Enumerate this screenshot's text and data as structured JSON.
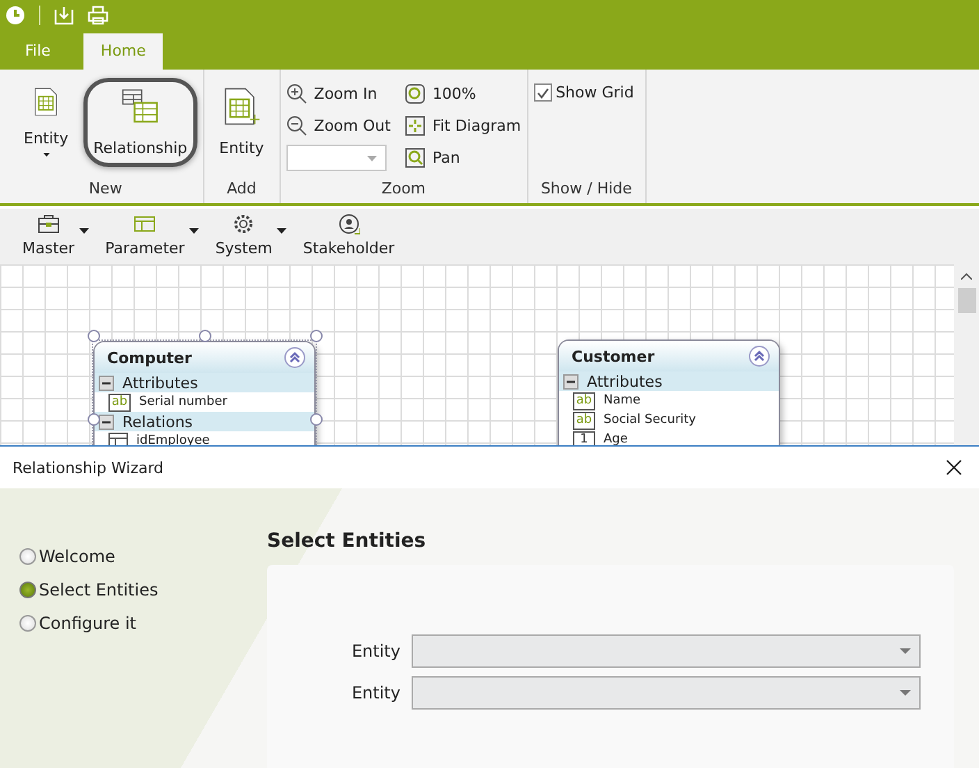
{
  "ribbon": {
    "tabs": [
      {
        "label": "File",
        "selected": false
      },
      {
        "label": "Home",
        "selected": true
      }
    ],
    "groups": [
      {
        "label": "New",
        "kind": "large",
        "buttons": [
          {
            "label": "Entity",
            "dropdown": true,
            "highlighted": false
          },
          {
            "label": "Relationship",
            "dropdown": false,
            "highlighted": true
          }
        ]
      },
      {
        "label": "Add",
        "kind": "large",
        "buttons": [
          {
            "label": "Entity",
            "dropdown": false,
            "highlighted": false
          }
        ]
      },
      {
        "label": "Zoom",
        "kind": "zoom",
        "buttons": [
          {
            "label": "Zoom In"
          },
          {
            "label": "Zoom Out"
          },
          {
            "label": "100%"
          },
          {
            "label": "Fit Diagram"
          },
          {
            "label": "Pan"
          }
        ]
      },
      {
        "label": "Show / Hide",
        "kind": "checks",
        "items": [
          {
            "label": "Show Grid",
            "checked": true
          }
        ]
      }
    ]
  },
  "toolbar": [
    {
      "label": "Master",
      "dropdown": true
    },
    {
      "label": "Parameter",
      "dropdown": true
    },
    {
      "label": "System",
      "dropdown": true
    },
    {
      "label": "Stakeholder",
      "dropdown": false
    }
  ],
  "diagram": {
    "entities": [
      {
        "title": "Computer",
        "selected": true,
        "sections": [
          {
            "label": "Attributes",
            "items": [
              {
                "label": "Serial number",
                "kind": "text",
                "badge": "ab"
              }
            ]
          },
          {
            "label": "Relations",
            "items": [
              {
                "label": "idEmployee",
                "kind": "relation"
              }
            ]
          }
        ]
      },
      {
        "title": "Customer",
        "selected": false,
        "sections": [
          {
            "label": "Attributes",
            "items": [
              {
                "label": "Name",
                "kind": "text",
                "badge": "ab"
              },
              {
                "label": "Social Security",
                "kind": "text",
                "badge": "ab"
              },
              {
                "label": "Age",
                "kind": "number",
                "badge": "1"
              }
            ]
          }
        ]
      }
    ]
  },
  "dialog": {
    "title": "Relationship Wizard",
    "steps": [
      {
        "label": "Welcome",
        "selected": false
      },
      {
        "label": "Select Entities",
        "selected": true
      },
      {
        "label": "Configure it",
        "selected": false
      }
    ],
    "heading": "Select Entities",
    "fields": [
      {
        "label": "Entity"
      },
      {
        "label": "Entity"
      }
    ]
  }
}
